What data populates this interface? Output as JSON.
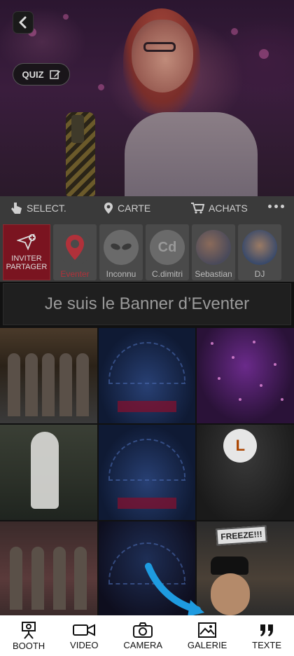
{
  "hero": {
    "back_icon": "chevron-left-icon",
    "quiz_label": "QUIZ",
    "quiz_icon": "edit-icon"
  },
  "action_bar": {
    "items": [
      {
        "label": "SELECT.",
        "icon": "hand-pointer-icon"
      },
      {
        "label": "CARTE",
        "icon": "map-pin-icon"
      },
      {
        "label": "ACHATS",
        "icon": "cart-icon"
      }
    ],
    "more_icon": "more-dots-icon"
  },
  "users": {
    "invite_label_1": "INVITER",
    "invite_label_2": "PARTAGER",
    "items": [
      {
        "label": "Eventer",
        "color": "#b0313a"
      },
      {
        "label": "Inconnu"
      },
      {
        "label": "C.dimitri",
        "initials": "Cd"
      },
      {
        "label": "Sebastian"
      },
      {
        "label": "DJ"
      }
    ]
  },
  "banner": {
    "text": "Je suis le Banner d’Eventer"
  },
  "gallery": {
    "freeze_text": "FREEZE!!!",
    "balloon_letter": "L"
  },
  "bottom_nav": {
    "items": [
      {
        "label": "BOOTH",
        "icon": "photo-booth-icon"
      },
      {
        "label": "VIDEO",
        "icon": "video-camera-icon"
      },
      {
        "label": "CAMERA",
        "icon": "camera-icon"
      },
      {
        "label": "GALERIE",
        "icon": "gallery-icon"
      },
      {
        "label": "TEXTE",
        "icon": "quote-icon"
      }
    ]
  },
  "colors": {
    "accent_red": "#7a1420",
    "arrow_blue": "#1e9be0"
  }
}
